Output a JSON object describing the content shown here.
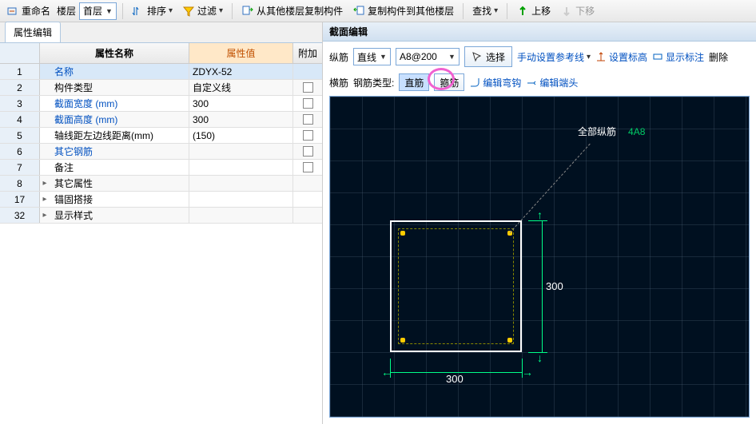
{
  "toolbar": {
    "rename": "重命名",
    "floor_lbl": "楼层",
    "floor_val": "首层",
    "sort": "排序",
    "filter": "过滤",
    "copy_from": "从其他楼层复制构件",
    "copy_to": "复制构件到其他楼层",
    "search": "查找",
    "move_up": "上移",
    "move_down": "下移"
  },
  "left": {
    "tab": "属性编辑",
    "col_name": "属性名称",
    "col_value": "属性值",
    "col_ext": "附加",
    "rows": [
      {
        "n": "1",
        "name": "名称",
        "val": "ZDYX-52",
        "link": true,
        "sel": true
      },
      {
        "n": "2",
        "name": "构件类型",
        "val": "自定义线",
        "link": false
      },
      {
        "n": "3",
        "name": "截面宽度 (mm)",
        "val": "300",
        "link": true
      },
      {
        "n": "4",
        "name": "截面高度 (mm)",
        "val": "300",
        "link": true
      },
      {
        "n": "5",
        "name": "轴线距左边线距离(mm)",
        "val": "(150)",
        "link": false
      },
      {
        "n": "6",
        "name": "其它钢筋",
        "val": "",
        "link": true
      },
      {
        "n": "7",
        "name": "备注",
        "val": "",
        "link": false
      },
      {
        "n": "8",
        "name": "其它属性",
        "val": "",
        "link": false,
        "exp": true
      },
      {
        "n": "17",
        "name": "锚固搭接",
        "val": "",
        "link": false,
        "exp": true
      },
      {
        "n": "32",
        "name": "显示样式",
        "val": "",
        "link": false,
        "exp": true
      }
    ]
  },
  "right": {
    "title": "截面编辑",
    "r1": {
      "zongj": "纵筋",
      "line_type": "直线",
      "spec": "A8@200",
      "select": "选择",
      "manual": "手动设置参考线",
      "set_label": "设置标高",
      "show_label": "显示标注",
      "delete": "删除"
    },
    "r2": {
      "hengj": "横筋",
      "rebar_type_lbl": "钢筋类型:",
      "straight": "直筋",
      "stirrup": "箍筋",
      "edit_bend": "编辑弯钩",
      "edit_end": "编辑端头"
    },
    "canvas": {
      "label_all": "全部纵筋",
      "label_spec": "4A8",
      "dim_w": "300",
      "dim_h": "300"
    }
  }
}
